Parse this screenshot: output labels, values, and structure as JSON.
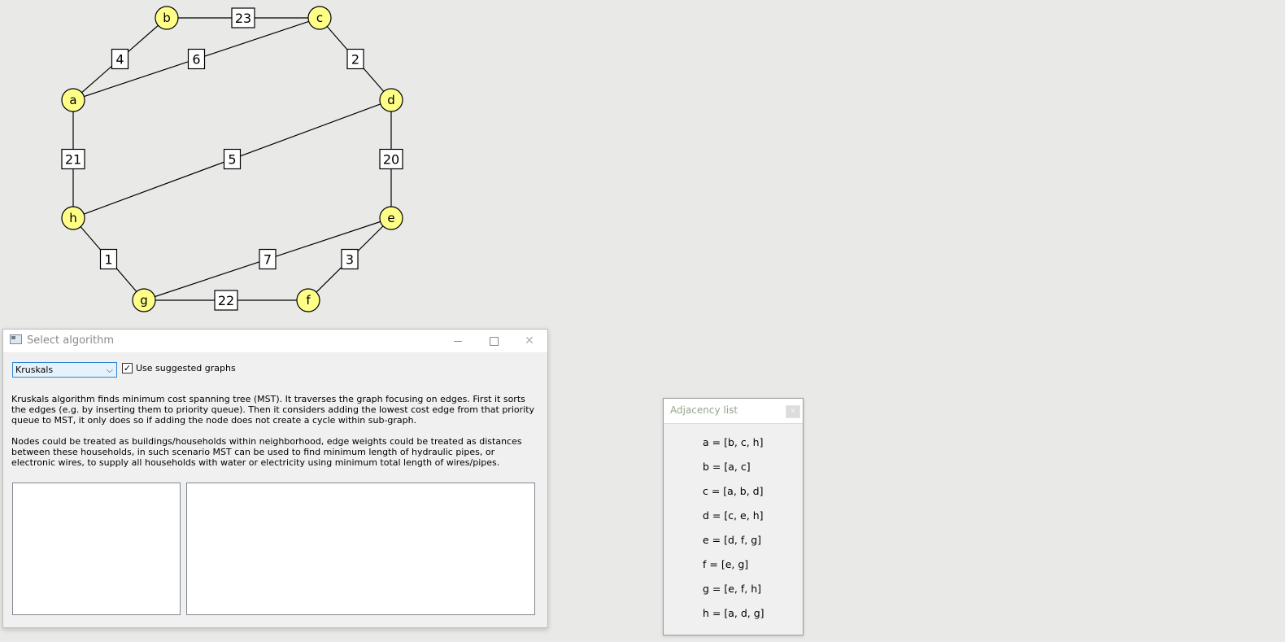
{
  "graph": {
    "nodes": [
      {
        "id": "b"
      },
      {
        "id": "c"
      },
      {
        "id": "a"
      },
      {
        "id": "d"
      },
      {
        "id": "h"
      },
      {
        "id": "e"
      },
      {
        "id": "g"
      },
      {
        "id": "f"
      }
    ],
    "edges": [
      {
        "from": "b",
        "to": "c",
        "weight": "23"
      },
      {
        "from": "a",
        "to": "b",
        "weight": "4"
      },
      {
        "from": "a",
        "to": "c",
        "weight": "6"
      },
      {
        "from": "c",
        "to": "d",
        "weight": "2"
      },
      {
        "from": "a",
        "to": "h",
        "weight": "21"
      },
      {
        "from": "h",
        "to": "d",
        "weight": "5"
      },
      {
        "from": "d",
        "to": "e",
        "weight": "20"
      },
      {
        "from": "h",
        "to": "g",
        "weight": "1"
      },
      {
        "from": "g",
        "to": "e",
        "weight": "7"
      },
      {
        "from": "e",
        "to": "f",
        "weight": "3"
      },
      {
        "from": "g",
        "to": "f",
        "weight": "22"
      }
    ],
    "colors": {
      "node_fill": "#ffff88",
      "node_stroke": "#000000",
      "edge": "#000000"
    }
  },
  "select_window": {
    "title": "Select algorithm",
    "algorithm_selected": "Kruskals",
    "use_suggested_checked": true,
    "use_suggested_label": "Use suggested graphs",
    "description_p1": "Kruskals algorithm finds minimum cost spanning tree (MST). It traverses the graph focusing on edges. First it sorts the edges (e.g. by inserting them to priority queue). Then it considers adding the lowest cost edge from that priority queue to MST, it only does so if adding the node does not create a cycle within sub-graph.",
    "description_p2": "Nodes could be treated as buildings/households within neighborhood, edge weights could be treated as distances between these households, in such scenario MST can be used to find minimum length of hydraulic pipes, or electronic wires, to supply all households with water or electricity using minimum total length of wires/pipes."
  },
  "adjacency_window": {
    "title": "Adjacency list",
    "entries": [
      "a = [b, c, h]",
      "b = [a, c]",
      "c = [a, b, d]",
      "d = [c, e, h]",
      "e = [d, f, g]",
      "f = [e, g]",
      "g = [e, f, h]",
      "h = [a, d, g]"
    ]
  }
}
